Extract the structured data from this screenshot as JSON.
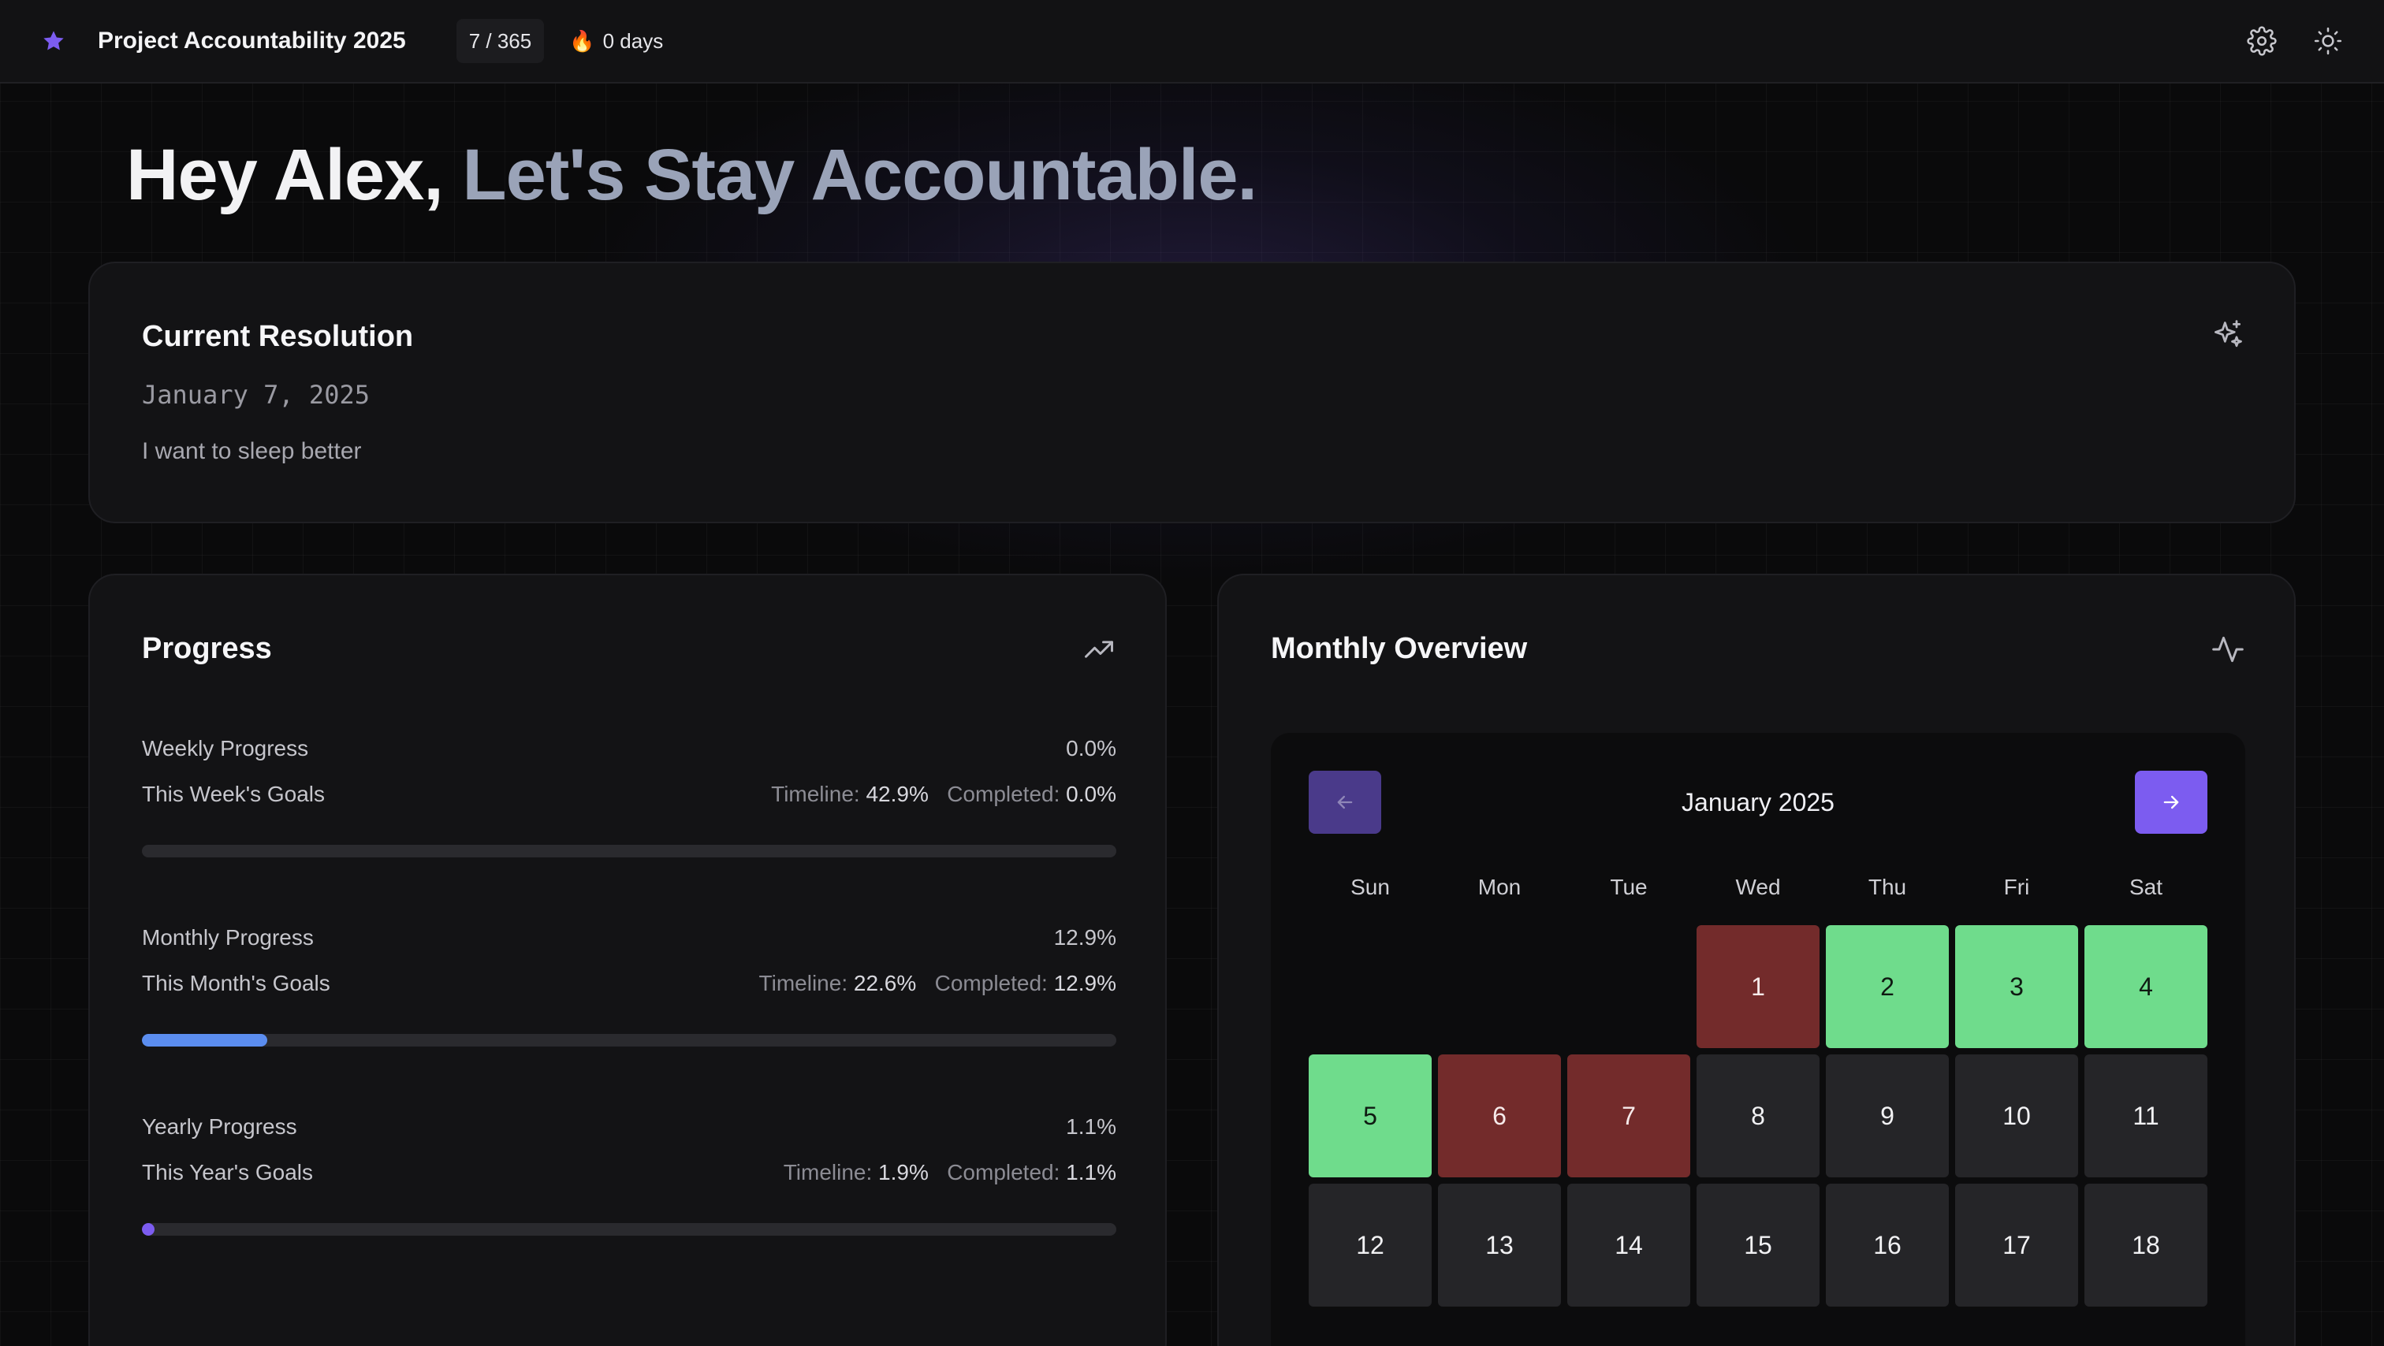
{
  "app": {
    "title": "Project Accountability 2025",
    "day_counter": "7 / 365",
    "streak_emoji": "🔥",
    "streak": "0 days"
  },
  "hero": {
    "greeting": "Hey Alex,",
    "tagline": "Let's Stay Accountable."
  },
  "resolution": {
    "title": "Current Resolution",
    "date": "January 7, 2025",
    "text": "I want to sleep better",
    "icon": "sparkles-icon"
  },
  "progress": {
    "title": "Progress",
    "icon": "trending-up-icon",
    "sections": [
      {
        "label": "Weekly Progress",
        "percent": "0.0%",
        "goals_label": "This Week's Goals",
        "timeline_label": "Timeline:",
        "timeline": "42.9%",
        "completed_label": "Completed:",
        "completed": "0.0%",
        "fill_fraction": 0.0,
        "color": "#5b8def"
      },
      {
        "label": "Monthly Progress",
        "percent": "12.9%",
        "goals_label": "This Month's Goals",
        "timeline_label": "Timeline:",
        "timeline": "22.6%",
        "completed_label": "Completed:",
        "completed": "12.9%",
        "fill_fraction": 0.129,
        "color": "#5b8def"
      },
      {
        "label": "Yearly Progress",
        "percent": "1.1%",
        "goals_label": "This Year's Goals",
        "timeline_label": "Timeline:",
        "timeline": "1.9%",
        "completed_label": "Completed:",
        "completed": "1.1%",
        "fill_fraction": 0.011,
        "color": "#7c5cf0"
      }
    ]
  },
  "overview": {
    "title": "Monthly Overview",
    "icon": "activity-icon",
    "month_label": "January 2025",
    "weekdays": [
      "Sun",
      "Mon",
      "Tue",
      "Wed",
      "Thu",
      "Fri",
      "Sat"
    ],
    "leading_blanks": 3,
    "days": [
      {
        "n": "1",
        "status": "missed"
      },
      {
        "n": "2",
        "status": "done"
      },
      {
        "n": "3",
        "status": "done"
      },
      {
        "n": "4",
        "status": "done"
      },
      {
        "n": "5",
        "status": "done"
      },
      {
        "n": "6",
        "status": "missed"
      },
      {
        "n": "7",
        "status": "missed"
      },
      {
        "n": "8",
        "status": "none"
      },
      {
        "n": "9",
        "status": "none"
      },
      {
        "n": "10",
        "status": "none"
      },
      {
        "n": "11",
        "status": "none"
      },
      {
        "n": "12",
        "status": "none"
      },
      {
        "n": "13",
        "status": "none"
      },
      {
        "n": "14",
        "status": "none"
      },
      {
        "n": "15",
        "status": "none"
      },
      {
        "n": "16",
        "status": "none"
      },
      {
        "n": "17",
        "status": "none"
      },
      {
        "n": "18",
        "status": "none"
      }
    ],
    "colors": {
      "done": "#6fdc8c",
      "missed": "#732b2b",
      "none": "#252528",
      "accent": "#7c5cf0"
    }
  }
}
